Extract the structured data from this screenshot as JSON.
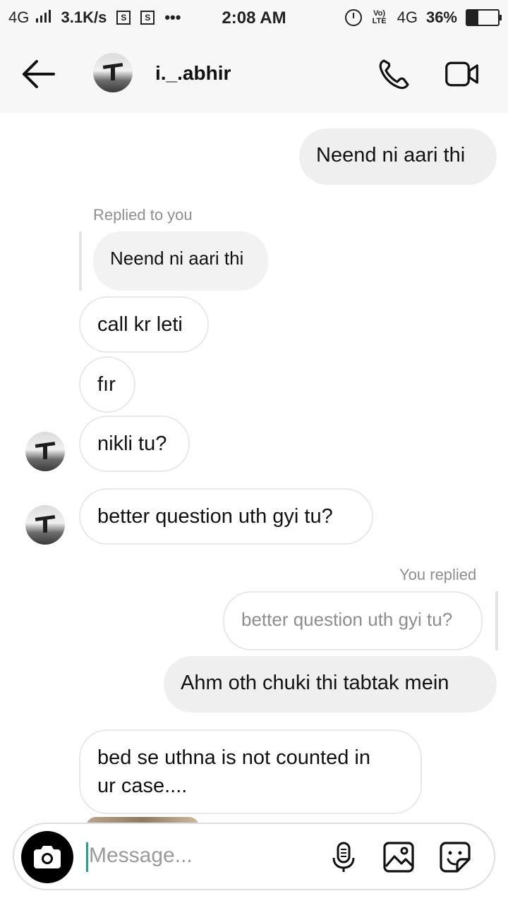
{
  "status_bar": {
    "network": "4G",
    "speed": "3.1K/s",
    "sim_badge": "S",
    "more": "•••",
    "time": "2:08 AM",
    "volte": "Vo) LTE",
    "network2": "4G",
    "battery": "36%"
  },
  "header": {
    "username": "i._.abhir"
  },
  "messages": {
    "m1": "Neend ni aari thi",
    "m2_meta": "Replied to you",
    "m2_quote": "Neend ni aari thi",
    "m3": "call kr leti",
    "m4": "fır",
    "m5": "nikli tu?",
    "m6": "better question uth gyi tu?",
    "m7_meta": "You replied",
    "m7_quote": "better question uth gyi tu?",
    "m8": "Ahm oth chuki thi tabtak mein",
    "m9_line1": "bed se uthna is not counted in",
    "m9_line2": "ur case...."
  },
  "composer": {
    "placeholder": "Message..."
  },
  "icons": {
    "back": "arrow-left-icon",
    "call": "phone-icon",
    "video": "video-camera-icon",
    "camera": "camera-icon",
    "mic": "microphone-icon",
    "gallery": "image-icon",
    "sticker": "sticker-icon"
  }
}
